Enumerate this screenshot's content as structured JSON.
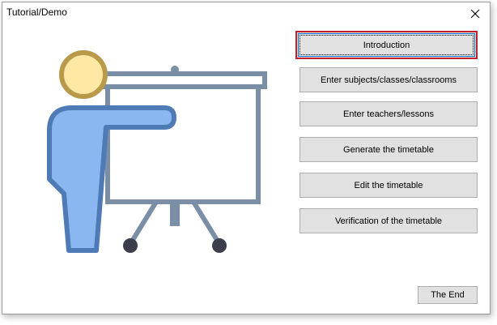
{
  "window": {
    "title": "Tutorial/Demo",
    "close_icon": "close-icon"
  },
  "illustration": {
    "icon": "presenter-whiteboard-illustration",
    "colors": {
      "head_fill": "#FFE8A3",
      "head_stroke": "#B89A4A",
      "body_fill": "#8BB7F0",
      "body_stroke": "#4E7AB5",
      "board_stroke": "#7A8FA6"
    }
  },
  "menu": {
    "buttons": [
      "Introduction",
      "Enter subjects/classes/classrooms",
      "Enter teachers/lessons",
      "Generate the timetable",
      "Edit the timetable",
      "Verification of the timetable"
    ],
    "focused_index": 0,
    "focus_color": "#C11F2B"
  },
  "footer": {
    "end_label": "The End"
  }
}
